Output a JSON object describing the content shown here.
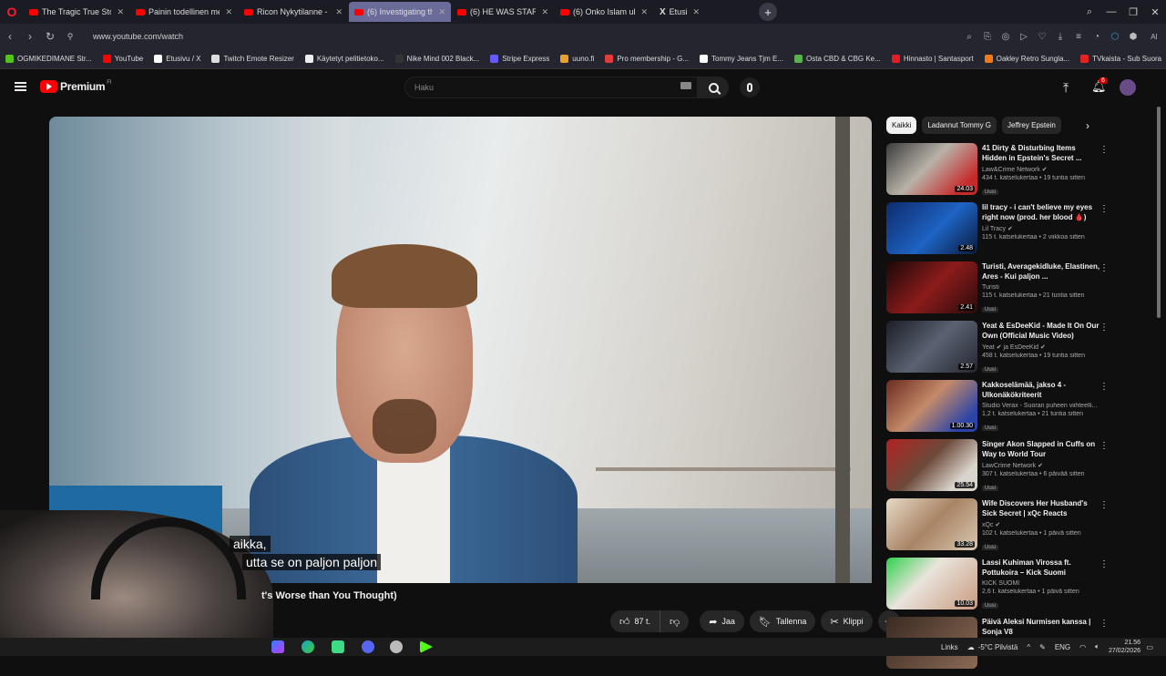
{
  "browser": {
    "tabs": [
      {
        "label": "The Tragic True Story of Ju",
        "kind": "yt",
        "active": false
      },
      {
        "label": "Painin todellinen merkity",
        "kind": "yt",
        "active": false
      },
      {
        "label": "Ricon Nykytilanne - YouTu",
        "kind": "yt",
        "active": false
      },
      {
        "label": "(6) Investigating the Unre",
        "kind": "yt",
        "active": true
      },
      {
        "label": "(6) HE WAS STARING 😮😮",
        "kind": "yt",
        "active": false
      },
      {
        "label": "(6) Onko Islam uhka länsi",
        "kind": "yt",
        "active": false
      },
      {
        "label": "Etusivu / X",
        "kind": "x",
        "active": false
      }
    ],
    "url": "www.youtube.com/watch",
    "bookmarks": [
      {
        "label": "OGMIKEDIMANE Str...",
        "color": "#53c41a"
      },
      {
        "label": "YouTube",
        "color": "#ff0000"
      },
      {
        "label": "Etusivu / X",
        "color": "#ffffff"
      },
      {
        "label": "Twitch Emote Resizer",
        "color": "#dddddd"
      },
      {
        "label": "Käytetyt pelitietoko...",
        "color": "#eeeeee"
      },
      {
        "label": "Nike Mind 002 Black...",
        "color": "#333333"
      },
      {
        "label": "Stripe Express",
        "color": "#635bff"
      },
      {
        "label": "uuno.fi",
        "color": "#e8a12b"
      },
      {
        "label": "Pro membership - G...",
        "color": "#e23b3b"
      },
      {
        "label": "Tommy Jeans Tjm E...",
        "color": "#ffffff"
      },
      {
        "label": "Osta CBD & CBG Ke...",
        "color": "#5ab04f"
      },
      {
        "label": "Hinnasto | Santasport",
        "color": "#e51b23"
      },
      {
        "label": "Oakley Retro Sungla...",
        "color": "#f07a19"
      },
      {
        "label": "TVkaista - Sub Suora",
        "color": "#e32424"
      }
    ]
  },
  "youtube": {
    "brand": "Premium",
    "brand_sup": "FI",
    "search_placeholder": "Haku",
    "notification_count": "6",
    "subtitles": [
      "aikka,",
      "utta se on paljon paljon"
    ],
    "video_title_fragment": "t's Worse than You Thought)",
    "actions": {
      "likes": "87 t.",
      "share": "Jaa",
      "save": "Tallenna",
      "clip": "Klippi"
    },
    "chips": [
      "Kaikki",
      "Ladannut Tommy G",
      "Jeffrey Epstein"
    ],
    "recommendations": [
      {
        "title": "41 Dirty & Disturbing Items Hidden in Epstein's Secret ...",
        "channel": "Law&Crime Network ✔",
        "meta": "434 t. katselukertaa • 19 tuntia sitten",
        "badge": "Uusi",
        "duration": "24.03",
        "thumb": "linear-gradient(135deg,#3b3b3b,#b9b2a8 45%,#c62a2a 85%)"
      },
      {
        "title": "lil tracy - i can't believe my eyes right now (prod. her blood 🩸)",
        "channel": "Lil Tracy ✔",
        "meta": "115 t. katselukertaa • 2 viikkoa sitten",
        "badge": "",
        "duration": "2.48",
        "thumb": "linear-gradient(135deg,#0d2b6b,#1e63c4 55%,#0a1a3a)"
      },
      {
        "title": "Turisti, Averagekidluke, Elastinen, Ares - Kui paljon ...",
        "channel": "Turisti",
        "meta": "115 t. katselukertaa • 21 tuntia sitten",
        "badge": "Uusi",
        "duration": "2.41",
        "thumb": "linear-gradient(135deg,#1a0808,#8c1b1b 50%,#2a0b0b)"
      },
      {
        "title": "Yeat & EsDeeKid - Made It On Our Own (Official Music Video)",
        "channel": "Yeat ✔ ja EsDeeKid ✔",
        "meta": "458 t. katselukertaa • 19 tuntia sitten",
        "badge": "Uusi",
        "duration": "2.57",
        "thumb": "linear-gradient(135deg,#1b1e26,#5a6272 50%,#23262e)"
      },
      {
        "title": "Kakkoselämää, jakso 4 - Ulkonäkökriteerit",
        "channel": "Studio Verax - Suoran puheen viihteelli...",
        "meta": "1,2 t. katselukertaa • 21 tuntia sitten",
        "badge": "Uusi",
        "duration": "1.00.30",
        "thumb": "linear-gradient(135deg,#6b2a1e,#c38a6a 45%,#2a44a8 85%)"
      },
      {
        "title": "Singer Akon Slapped in Cuffs on Way to World Tour",
        "channel": "LawCrime Network ✔",
        "meta": "307 t. katselukertaa • 6 päivää sitten",
        "badge": "Uusi",
        "duration": "25.54",
        "thumb": "linear-gradient(135deg,#b22222,#6b4a3a 45%,#d9d4cc 80%)"
      },
      {
        "title": "Wife Discovers Her Husband's Sick Secret | xQc Reacts",
        "channel": "xQc ✔",
        "meta": "102 t. katselukertaa • 1 päivä sitten",
        "badge": "Uusi",
        "duration": "33.28",
        "thumb": "linear-gradient(135deg,#e7d9c6,#a88465 50%,#d8c7b0)"
      },
      {
        "title": "Lassi Kuhiman Virossa ft. Pottukoira – Kick Suomi",
        "channel": "KICK SUOMI",
        "meta": "2,6 t. katselukertaa • 1 päivä sitten",
        "badge": "Uusi",
        "duration": "10.03",
        "thumb": "linear-gradient(135deg,#2fd14a,#e9e4dc 40%,#c99a80)"
      },
      {
        "title": "Päivä Aleksi Nurmisen kanssa | Sonja V8",
        "channel": "",
        "meta": "",
        "badge": "",
        "duration": "",
        "thumb": "linear-gradient(135deg,#3a2a22,#8a6a55)"
      }
    ]
  },
  "taskbar": {
    "links": "Links",
    "weather": "-5°C  Pilvistä",
    "lang": "ENG",
    "time": "21.56",
    "date": "27/02/2026"
  }
}
